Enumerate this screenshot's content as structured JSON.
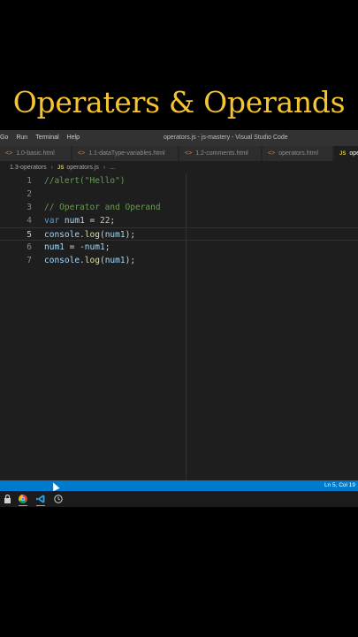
{
  "video_title": "Operaters & Operands",
  "titlebar": {
    "menu": [
      "Go",
      "Run",
      "Terminal",
      "Help"
    ],
    "window_title": "operators.js - js-mastery - Visual Studio Code"
  },
  "tabs": [
    {
      "label": "1.0-basic.html"
    },
    {
      "label": "1.1-dataType-variables.html"
    },
    {
      "label": "1.2-comments.html"
    },
    {
      "label": "operators.html"
    },
    {
      "label": "ope"
    }
  ],
  "breadcrumb": {
    "folder": "1.3-operators",
    "file": "operators.js",
    "more": "..."
  },
  "code_lines": [
    {
      "num": "1"
    },
    {
      "num": "2"
    },
    {
      "num": "3"
    },
    {
      "num": "4"
    },
    {
      "num": "5"
    },
    {
      "num": "6"
    },
    {
      "num": "7"
    }
  ],
  "code": {
    "l1_comment": "//alert(\"Hello\")",
    "l3_comment": "// Operator and Operand",
    "kw_var": "var",
    "num1": "num1",
    "eq": " = ",
    "value_22": "22",
    "semi": ";",
    "console": "console",
    "dot": ".",
    "log": "log",
    "open": "(",
    "close": ")",
    "neg": "-"
  },
  "status": {
    "position": "Ln 5, Col 19"
  },
  "colors": {
    "title_accent": "#f5c431",
    "status_bar": "#007acc",
    "editor_bg": "#1e1e1e"
  }
}
